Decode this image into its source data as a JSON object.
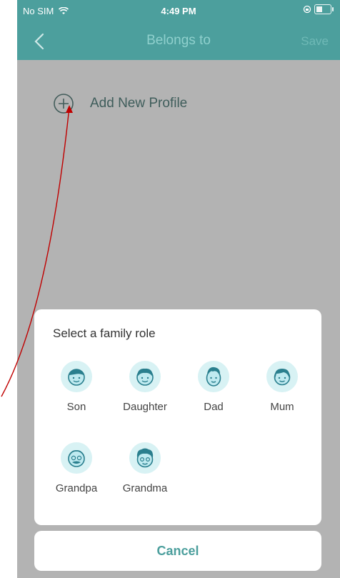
{
  "status_bar": {
    "carrier": "No SIM",
    "time": "4:49 PM"
  },
  "nav": {
    "title": "Belongs to",
    "save_label": "Save"
  },
  "add_profile": {
    "label": "Add New Profile"
  },
  "role_sheet": {
    "title": "Select a family role",
    "roles": [
      {
        "label": "Son",
        "icon": "son-face-icon"
      },
      {
        "label": "Daughter",
        "icon": "daughter-face-icon"
      },
      {
        "label": "Dad",
        "icon": "dad-face-icon"
      },
      {
        "label": "Mum",
        "icon": "mum-face-icon"
      },
      {
        "label": "Grandpa",
        "icon": "grandpa-face-icon"
      },
      {
        "label": "Grandma",
        "icon": "grandma-face-icon"
      }
    ]
  },
  "cancel_label": "Cancel",
  "colors": {
    "header": "#4c9f9d",
    "accent": "#4c9f9d",
    "dim_overlay": "#b3b3b3",
    "annotation": "#c00000"
  }
}
